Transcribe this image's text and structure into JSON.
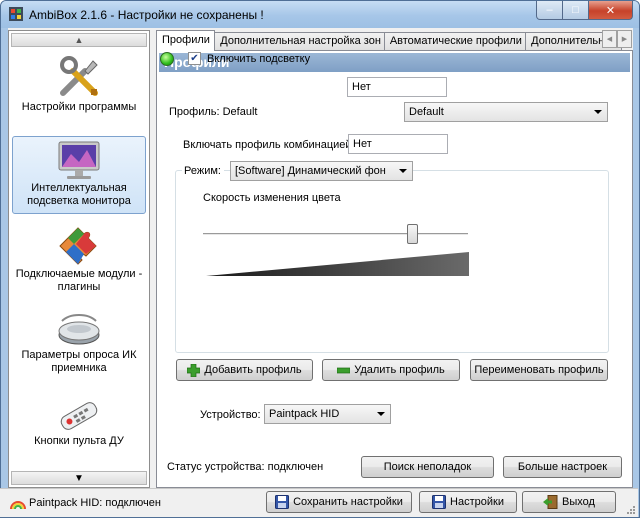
{
  "window": {
    "title": "AmbiBox 2.1.6  - Настройки не сохранены !",
    "buttons": {
      "minimize": "‒",
      "maximize": "□",
      "close": "✕"
    }
  },
  "sidebar": {
    "scroll_up": "▲",
    "scroll_down": "▼",
    "items": [
      {
        "label": "Настройки программы",
        "icon": "tools-icon"
      },
      {
        "label": "Интеллектуальная подсветка монитора",
        "icon": "monitor-icon",
        "selected": true
      },
      {
        "label": "Подключаемые модули - плагины",
        "icon": "puzzle-icon"
      },
      {
        "label": "Параметры опроса ИК приемника",
        "icon": "ir-receiver-icon"
      },
      {
        "label": "Кнопки пульта ДУ",
        "icon": "remote-icon"
      }
    ]
  },
  "tabs": [
    {
      "label": "Профили",
      "active": true
    },
    {
      "label": "Дополнительная настройка зон"
    },
    {
      "label": "Автоматические профили"
    },
    {
      "label": "Дополнительные н"
    }
  ],
  "panel": {
    "header": "Профили",
    "enable_label": "Включить подсветку",
    "enable_checked": true,
    "enable_hotkey": "Нет",
    "profile_label": "Профиль: Default",
    "profile_value": "Default",
    "profile_hotkey_label": "Включать профиль комбинацией:",
    "profile_hotkey": "Нет",
    "mode_label": "Режим:",
    "mode_value": "[Software] Динамический фон",
    "speed_label": "Скорость изменения цвета",
    "speed_value": 0.79,
    "add_profile": "Добавить профиль",
    "delete_profile": "Удалить профиль",
    "rename_profile": "Переименовать профиль",
    "device_label": "Устройство:",
    "device_value": "Paintpack HID",
    "device_status": "Статус устройства: подключен",
    "troubleshoot": "Поиск неполадок",
    "more_settings": "Больше настроек"
  },
  "statusbar": {
    "device_status": "Paintpack HID: подключен",
    "save": "Сохранить настройки",
    "settings": "Настройки",
    "exit": "Выход"
  },
  "colors": {
    "title_bar": "#a6c6e8",
    "panel_header": "#8aa8cc",
    "led_on": "#2fbe1c"
  }
}
